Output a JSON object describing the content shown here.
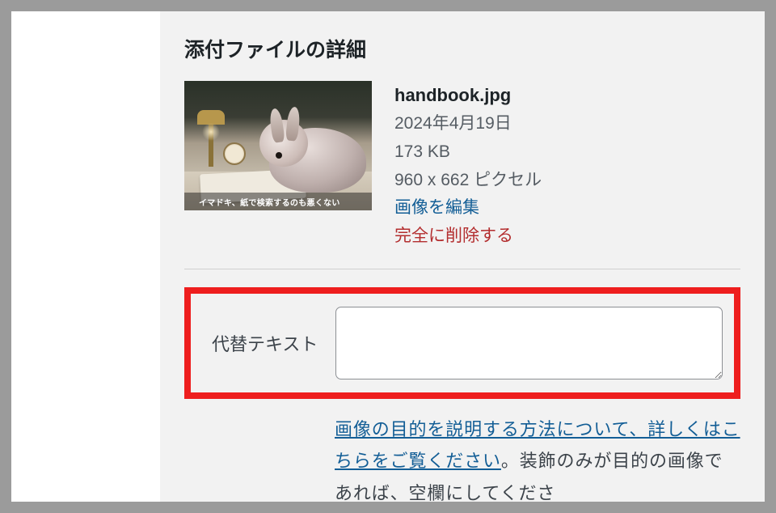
{
  "section_title": "添付ファイルの詳細",
  "thumbnail": {
    "caption": "イマドキ、紙で検索するのも悪くない"
  },
  "meta": {
    "filename": "handbook.jpg",
    "date": "2024年4月19日",
    "filesize": "173 KB",
    "dimensions": "960 x 662 ピクセル",
    "edit_label": "画像を編集",
    "delete_label": "完全に削除する"
  },
  "alt_text": {
    "label": "代替テキスト",
    "value": ""
  },
  "help": {
    "link_text": "画像の目的を説明する方法について、詳しくはこちらをご覧ください",
    "suffix": "。装飾のみが目的の画像であれば、空欄にしてくださ"
  }
}
